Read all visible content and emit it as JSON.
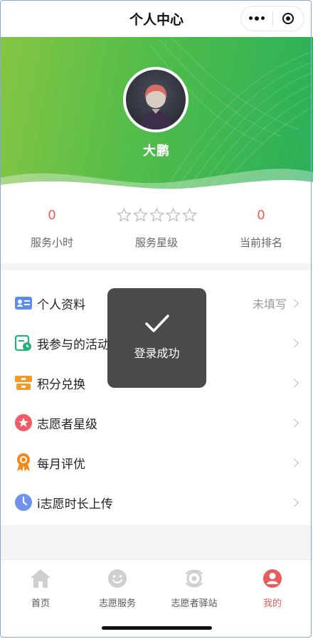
{
  "header": {
    "title": "个人中心"
  },
  "profile": {
    "name": "大鹏"
  },
  "stats": [
    {
      "value": "0",
      "label": "服务小时"
    },
    {
      "rating": 0,
      "max": 5,
      "label": "服务星级"
    },
    {
      "value": "0",
      "label": "当前排名"
    }
  ],
  "menu": [
    {
      "label": "个人资料",
      "right": "未填写",
      "icon": "profile-card-icon",
      "color": "#5b8def"
    },
    {
      "label": "我参与的活动",
      "icon": "activity-calendar-icon",
      "color": "#27b07a"
    },
    {
      "label": "积分兑换",
      "icon": "points-exchange-icon",
      "color": "#f39a2b"
    },
    {
      "label": "志愿者星级",
      "icon": "star-badge-icon",
      "color": "#ef5b67"
    },
    {
      "label": "每月评优",
      "icon": "award-medal-icon",
      "color": "#f28a1d"
    },
    {
      "label": "i志愿时长上传",
      "icon": "clock-icon",
      "color": "#6f92f0"
    }
  ],
  "toast": {
    "message": "登录成功"
  },
  "tabbar": [
    {
      "label": "首页",
      "icon": "home-icon"
    },
    {
      "label": "志愿服务",
      "icon": "smile-icon"
    },
    {
      "label": "志愿者驿站",
      "icon": "station-icon"
    },
    {
      "label": "我的",
      "icon": "user-icon",
      "active": true
    }
  ],
  "colors": {
    "accent": "#ef5b4c",
    "hero_start": "#86c544",
    "hero_end": "#2aaf5a",
    "active_tab": "#e85c5c"
  }
}
